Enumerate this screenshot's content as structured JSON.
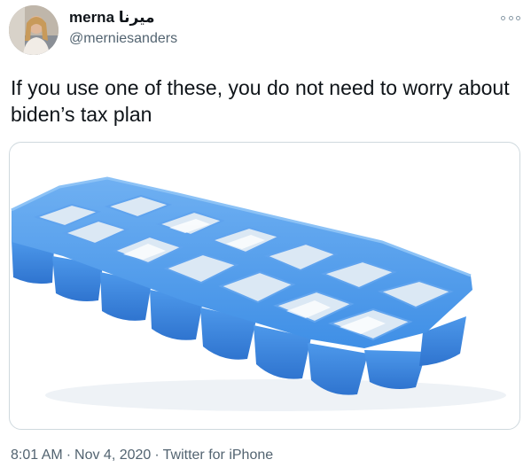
{
  "user": {
    "display_name": "merna ميرنا",
    "handle": "@merniesanders"
  },
  "tweet": {
    "text": "If you use one of these, you do not need to worry about biden’s tax plan"
  },
  "meta": {
    "time": "8:01 AM",
    "separator": "·",
    "date": "Nov 4, 2020",
    "source": "Twitter for iPhone"
  },
  "icons": {
    "more": "more-options-icon"
  },
  "colors": {
    "ice_tray_blue": "#3f8fe6",
    "text_secondary": "#536471"
  }
}
